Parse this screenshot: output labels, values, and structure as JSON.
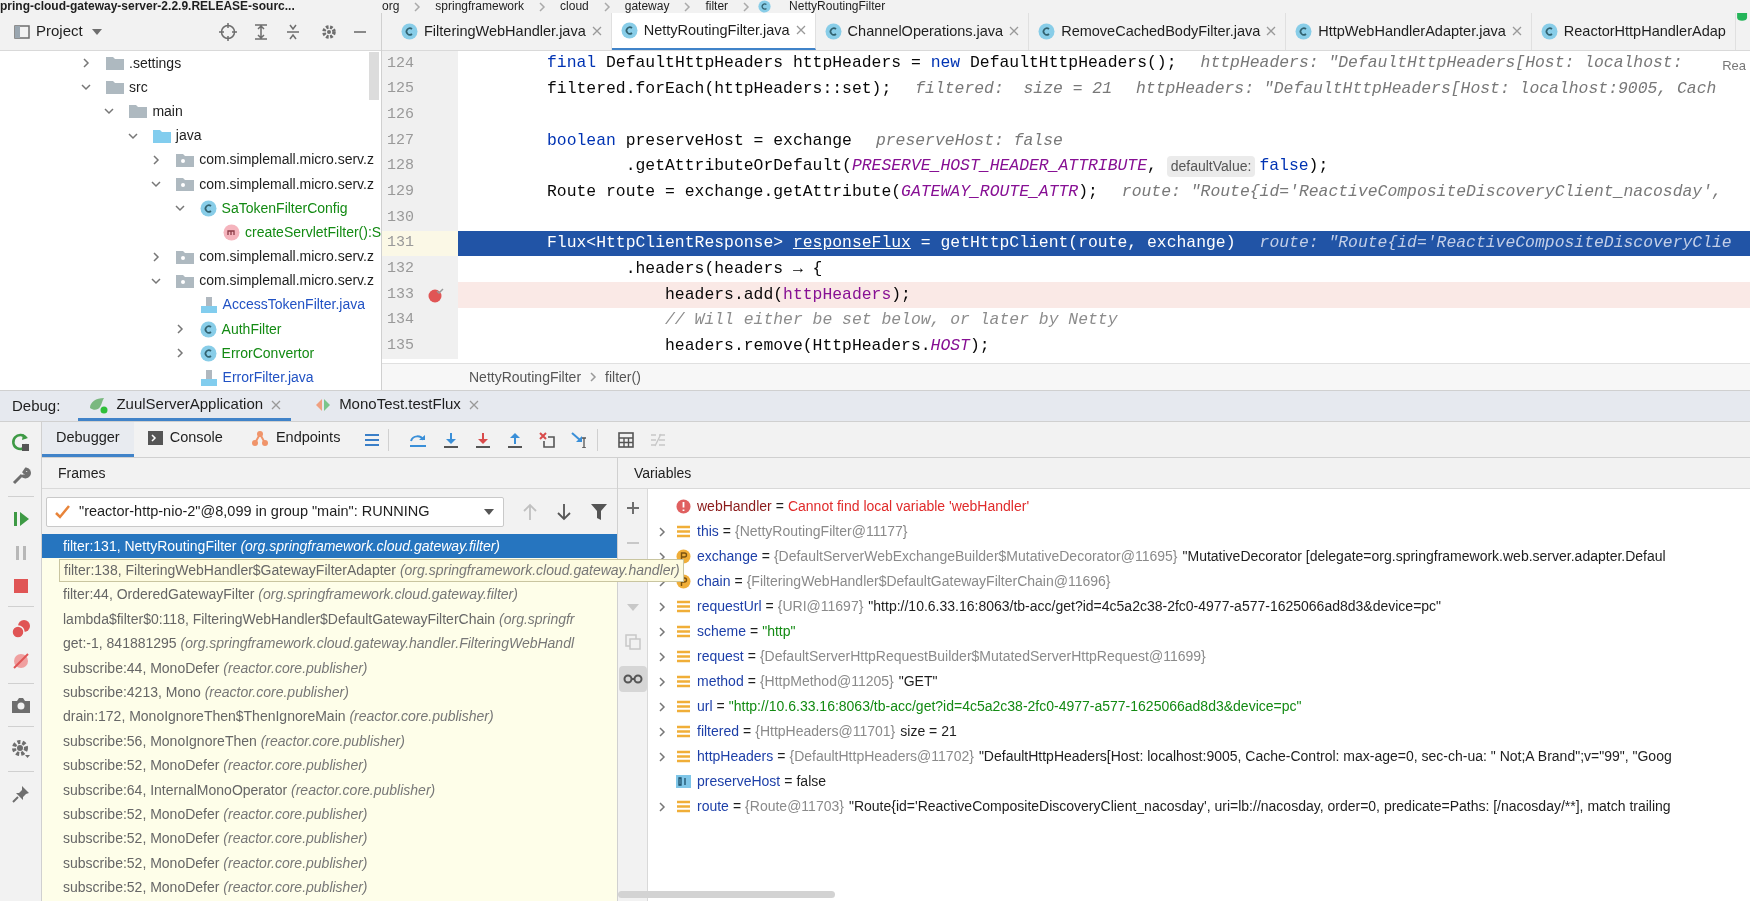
{
  "path_bar": {
    "project": "pring-cloud-gateway-server-2.2.9.RELEASE-sourc...",
    "segments": [
      "org",
      "springframework",
      "cloud",
      "gateway",
      "filter",
      "NettyRoutingFilter"
    ]
  },
  "project_panel": {
    "title": "Project",
    "tree": [
      {
        "label": ".settings",
        "kind": "folder",
        "expanded": false
      },
      {
        "label": "src",
        "kind": "folder",
        "expanded": true,
        "children": [
          {
            "label": "main",
            "kind": "folder",
            "expanded": true,
            "children": [
              {
                "label": "java",
                "kind": "source",
                "expanded": true,
                "children": [
                  {
                    "label": "com.simplemall.micro.serv.z",
                    "kind": "package",
                    "expanded": false
                  },
                  {
                    "label": "com.simplemall.micro.serv.z",
                    "kind": "package",
                    "expanded": true,
                    "children": [
                      {
                        "label": "SaTokenFilterConfig",
                        "kind": "class",
                        "color": "#138a13",
                        "expanded": true,
                        "children": [
                          {
                            "label": "createServletFilter():S",
                            "kind": "method",
                            "color": "#138a13"
                          }
                        ]
                      }
                    ]
                  },
                  {
                    "label": "com.simplemall.micro.serv.z",
                    "kind": "package",
                    "expanded": false
                  },
                  {
                    "label": "com.simplemall.micro.serv.z",
                    "kind": "package",
                    "expanded": true,
                    "children": [
                      {
                        "label": "AccessTokenFilter.java",
                        "kind": "file",
                        "color": "#2152c4"
                      },
                      {
                        "label": "AuthFilter",
                        "kind": "class",
                        "color": "#138a13",
                        "expanded": false
                      },
                      {
                        "label": "ErrorConvertor",
                        "kind": "class",
                        "color": "#138a13",
                        "expanded": false
                      },
                      {
                        "label": "ErrorFilter.java",
                        "kind": "file",
                        "color": "#2152c4"
                      }
                    ]
                  }
                ]
              }
            ]
          }
        ]
      }
    ]
  },
  "editor": {
    "tabs": [
      {
        "label": "FilteringWebHandler.java",
        "selected": false,
        "closable": true
      },
      {
        "label": "NettyRoutingFilter.java",
        "selected": true,
        "closable": true
      },
      {
        "label": "ChannelOperations.java",
        "selected": false,
        "closable": true
      },
      {
        "label": "RemoveCachedBodyFilter.java",
        "selected": false,
        "closable": true
      },
      {
        "label": "HttpWebHandlerAdapter.java",
        "selected": false,
        "closable": true
      },
      {
        "label": "ReactorHttpHandlerAdap",
        "selected": false,
        "closable": false
      }
    ],
    "reader_mode": "Rea",
    "lines": [
      {
        "number": "124",
        "execution": false,
        "breakpoint": false,
        "tokens": [
          {
            "kind": "keyword",
            "text": "final"
          },
          {
            "kind": "plain",
            "text": " DefaultHttpHeaders httpHeaders = "
          },
          {
            "kind": "keyword",
            "text": "new"
          },
          {
            "kind": "plain",
            "text": " DefaultHttpHeaders();"
          },
          {
            "kind": "hint",
            "text": "httpHeaders: \"DefaultHttpHeaders[Host: localhost:"
          }
        ]
      },
      {
        "number": "125",
        "execution": false,
        "breakpoint": false,
        "tokens": [
          {
            "kind": "plain",
            "text": "filtered.forEach(httpHeaders::set);"
          },
          {
            "kind": "hint",
            "text": "filtered:  size = 21"
          },
          {
            "kind": "hint",
            "text": "httpHeaders: \"DefaultHttpHeaders[Host: localhost:9005, Cach"
          }
        ]
      },
      {
        "number": "126",
        "execution": false,
        "breakpoint": false
      },
      {
        "number": "127",
        "execution": false,
        "breakpoint": false,
        "tokens": [
          {
            "kind": "keyword",
            "text": "boolean"
          },
          {
            "kind": "plain",
            "text": " preserveHost = exchange"
          },
          {
            "kind": "hint",
            "text": "preserveHost: false"
          }
        ]
      },
      {
        "number": "128",
        "execution": false,
        "breakpoint": false,
        "tokens": [
          {
            "kind": "plain",
            "text": "        .getAttributeOrDefault("
          },
          {
            "kind": "constant",
            "text": "PRESERVE_HOST_HEADER_ATTRIBUTE"
          },
          {
            "kind": "plain",
            "text": ", "
          },
          {
            "kind": "inlay",
            "text": "defaultValue:"
          },
          {
            "kind": "keyword",
            "text": "false"
          },
          {
            "kind": "plain",
            "text": ");"
          }
        ]
      },
      {
        "number": "129",
        "execution": false,
        "breakpoint": false,
        "tokens": [
          {
            "kind": "plain",
            "text": "Route route = exchange.getAttribute("
          },
          {
            "kind": "constant",
            "text": "GATEWAY_ROUTE_ATTR"
          },
          {
            "kind": "plain",
            "text": ");"
          },
          {
            "kind": "hint",
            "text": "route: \"Route{id='ReactiveCompositeDiscoveryClient_nacosday',"
          }
        ]
      },
      {
        "number": "130",
        "execution": false,
        "breakpoint": false
      },
      {
        "number": "131",
        "execution": true,
        "breakpoint": false,
        "tokens": [
          {
            "kind": "plain",
            "text": "Flux<HttpClientResponse> "
          },
          {
            "kind": "underlined",
            "text": "responseFlux"
          },
          {
            "kind": "plain",
            "text": " = getHttpClient(route, exchange)"
          },
          {
            "kind": "hint",
            "text": "route: \"Route{id='ReactiveCompositeDiscoveryClie"
          }
        ]
      },
      {
        "number": "132",
        "execution": false,
        "breakpoint": false,
        "tokens": [
          {
            "kind": "plain",
            "text": "        .headers(headers → {"
          }
        ]
      },
      {
        "number": "133",
        "execution": false,
        "breakpoint": true,
        "tokens": [
          {
            "kind": "plain",
            "text": "            headers.add("
          },
          {
            "kind": "field",
            "text": "httpHeaders"
          },
          {
            "kind": "plain",
            "text": ");"
          }
        ]
      },
      {
        "number": "134",
        "execution": false,
        "breakpoint": false,
        "tokens": [
          {
            "kind": "comment",
            "text": "            // Will either be set below, or later by Netty"
          }
        ]
      },
      {
        "number": "135",
        "execution": false,
        "breakpoint": false,
        "tokens": [
          {
            "kind": "plain",
            "text": "            headers.remove(HttpHeaders."
          },
          {
            "kind": "constant",
            "text": "HOST"
          },
          {
            "kind": "plain",
            "text": ");"
          }
        ]
      }
    ],
    "breadcrumb": [
      "NettyRoutingFilter",
      "filter()"
    ]
  },
  "debug": {
    "label": "Debug:",
    "sessions": [
      {
        "label": "ZuulServerApplication",
        "selected": true
      },
      {
        "label": "MonoTest.testFlux",
        "selected": false
      }
    ],
    "tabs": [
      {
        "label": "Debugger",
        "selected": true
      },
      {
        "label": "Console",
        "selected": false
      },
      {
        "label": "Endpoints",
        "selected": false
      }
    ],
    "frames": {
      "title": "Frames",
      "thread": "\"reactor-http-nio-2\"@8,099 in group \"main\": RUNNING",
      "items": [
        {
          "method": "filter:131, NettyRoutingFilter",
          "package": "(org.springframework.cloud.gateway.filter)",
          "selected": true,
          "hovered": false
        },
        {
          "method": "filter:138, FilteringWebHandler$GatewayFilterAdapter",
          "package": "(org.springframework.cloud.gateway.handler)",
          "selected": false,
          "hovered": true
        },
        {
          "method": "filter:44, OrderedGatewayFilter",
          "package": "(org.springframework.cloud.gateway.filter)",
          "selected": false,
          "hovered": false
        },
        {
          "method": "lambda$filter$0:118, FilteringWebHandler$DefaultGatewayFilterChain",
          "package": "(org.springfr",
          "selected": false,
          "hovered": false
        },
        {
          "method": "get:-1, 841881295",
          "package": "(org.springframework.cloud.gateway.handler.FilteringWebHandl",
          "selected": false,
          "hovered": false
        },
        {
          "method": "subscribe:44, MonoDefer",
          "package": "(reactor.core.publisher)",
          "selected": false,
          "hovered": false
        },
        {
          "method": "subscribe:4213, Mono",
          "package": "(reactor.core.publisher)",
          "selected": false,
          "hovered": false
        },
        {
          "method": "drain:172, MonoIgnoreThen$ThenIgnoreMain",
          "package": "(reactor.core.publisher)",
          "selected": false,
          "hovered": false
        },
        {
          "method": "subscribe:56, MonoIgnoreThen",
          "package": "(reactor.core.publisher)",
          "selected": false,
          "hovered": false
        },
        {
          "method": "subscribe:52, MonoDefer",
          "package": "(reactor.core.publisher)",
          "selected": false,
          "hovered": false
        },
        {
          "method": "subscribe:64, InternalMonoOperator",
          "package": "(reactor.core.publisher)",
          "selected": false,
          "hovered": false
        },
        {
          "method": "subscribe:52, MonoDefer",
          "package": "(reactor.core.publisher)",
          "selected": false,
          "hovered": false
        },
        {
          "method": "subscribe:52, MonoDefer",
          "package": "(reactor.core.publisher)",
          "selected": false,
          "hovered": false
        },
        {
          "method": "subscribe:52, MonoDefer",
          "package": "(reactor.core.publisher)",
          "selected": false,
          "hovered": false
        },
        {
          "method": "subscribe:52, MonoDefer",
          "package": "(reactor.core.publisher)",
          "selected": false,
          "hovered": false
        }
      ]
    },
    "variables": {
      "title": "Variables",
      "items": [
        {
          "name": "webHandler",
          "kind": "error",
          "expandable": false,
          "sep": "=",
          "value": "Cannot find local variable 'webHandler'",
          "color": "#e02a2a"
        },
        {
          "name": "this",
          "kind": "field",
          "expandable": true,
          "sep": "=",
          "type": "{NettyRoutingFilter@11177}"
        },
        {
          "name": "exchange",
          "kind": "param",
          "expandable": true,
          "sep": "=",
          "type": "{DefaultServerWebExchangeBuilder$MutativeDecorator@11695}",
          "value": "\"MutativeDecorator [delegate=org.springframework.web.server.adapter.Defaul",
          "color": "#1e1e1e"
        },
        {
          "name": "chain",
          "kind": "param",
          "expandable": true,
          "sep": "=",
          "type": "{FilteringWebHandler$DefaultGatewayFilterChain@11696}"
        },
        {
          "name": "requestUrl",
          "kind": "field",
          "expandable": true,
          "sep": "=",
          "type": "{URI@11697}",
          "value": "\"http://10.6.33.16:8063/tb-acc/get?id=4c5a2c38-2fc0-4977-a577-1625066ad8d3&device=pc\"",
          "color": "#1e1e1e"
        },
        {
          "name": "scheme",
          "kind": "field",
          "expandable": true,
          "sep": "=",
          "value": "\"http\"",
          "color": "#138a13"
        },
        {
          "name": "request",
          "kind": "field",
          "expandable": true,
          "sep": "=",
          "type": "{DefaultServerHttpRequestBuilder$MutatedServerHttpRequest@11699}"
        },
        {
          "name": "method",
          "kind": "field",
          "expandable": true,
          "sep": "=",
          "type": "{HttpMethod@11205}",
          "value": "\"GET\"",
          "color": "#1e1e1e"
        },
        {
          "name": "url",
          "kind": "field",
          "expandable": true,
          "sep": "=",
          "value": "\"http://10.6.33.16:8063/tb-acc/get?id=4c5a2c38-2fc0-4977-a577-1625066ad8d3&device=pc\"",
          "color": "#138a13"
        },
        {
          "name": "filtered",
          "kind": "field",
          "expandable": true,
          "sep": "=",
          "type": "{HttpHeaders@11701}",
          "value": "size = 21",
          "color": "#1e1e1e"
        },
        {
          "name": "httpHeaders",
          "kind": "field",
          "expandable": true,
          "sep": "=",
          "type": "{DefaultHttpHeaders@11702}",
          "value": "\"DefaultHttpHeaders[Host: localhost:9005, Cache-Control: max-age=0, sec-ch-ua: \" Not;A Brand\";v=\"99\", \"Goog",
          "color": "#1e1e1e"
        },
        {
          "name": "preserveHost",
          "kind": "primitive",
          "expandable": false,
          "sep": "=",
          "value": "false",
          "color": "#1e1e1e"
        },
        {
          "name": "route",
          "kind": "field",
          "expandable": true,
          "sep": "=",
          "type": "{Route@11703}",
          "value": "\"Route{id='ReactiveCompositeDiscoveryClient_nacosday', uri=lb://nacosday, order=0, predicate=Paths: [/nacosday/**], match trailing",
          "color": "#1e1e1e"
        }
      ]
    }
  }
}
